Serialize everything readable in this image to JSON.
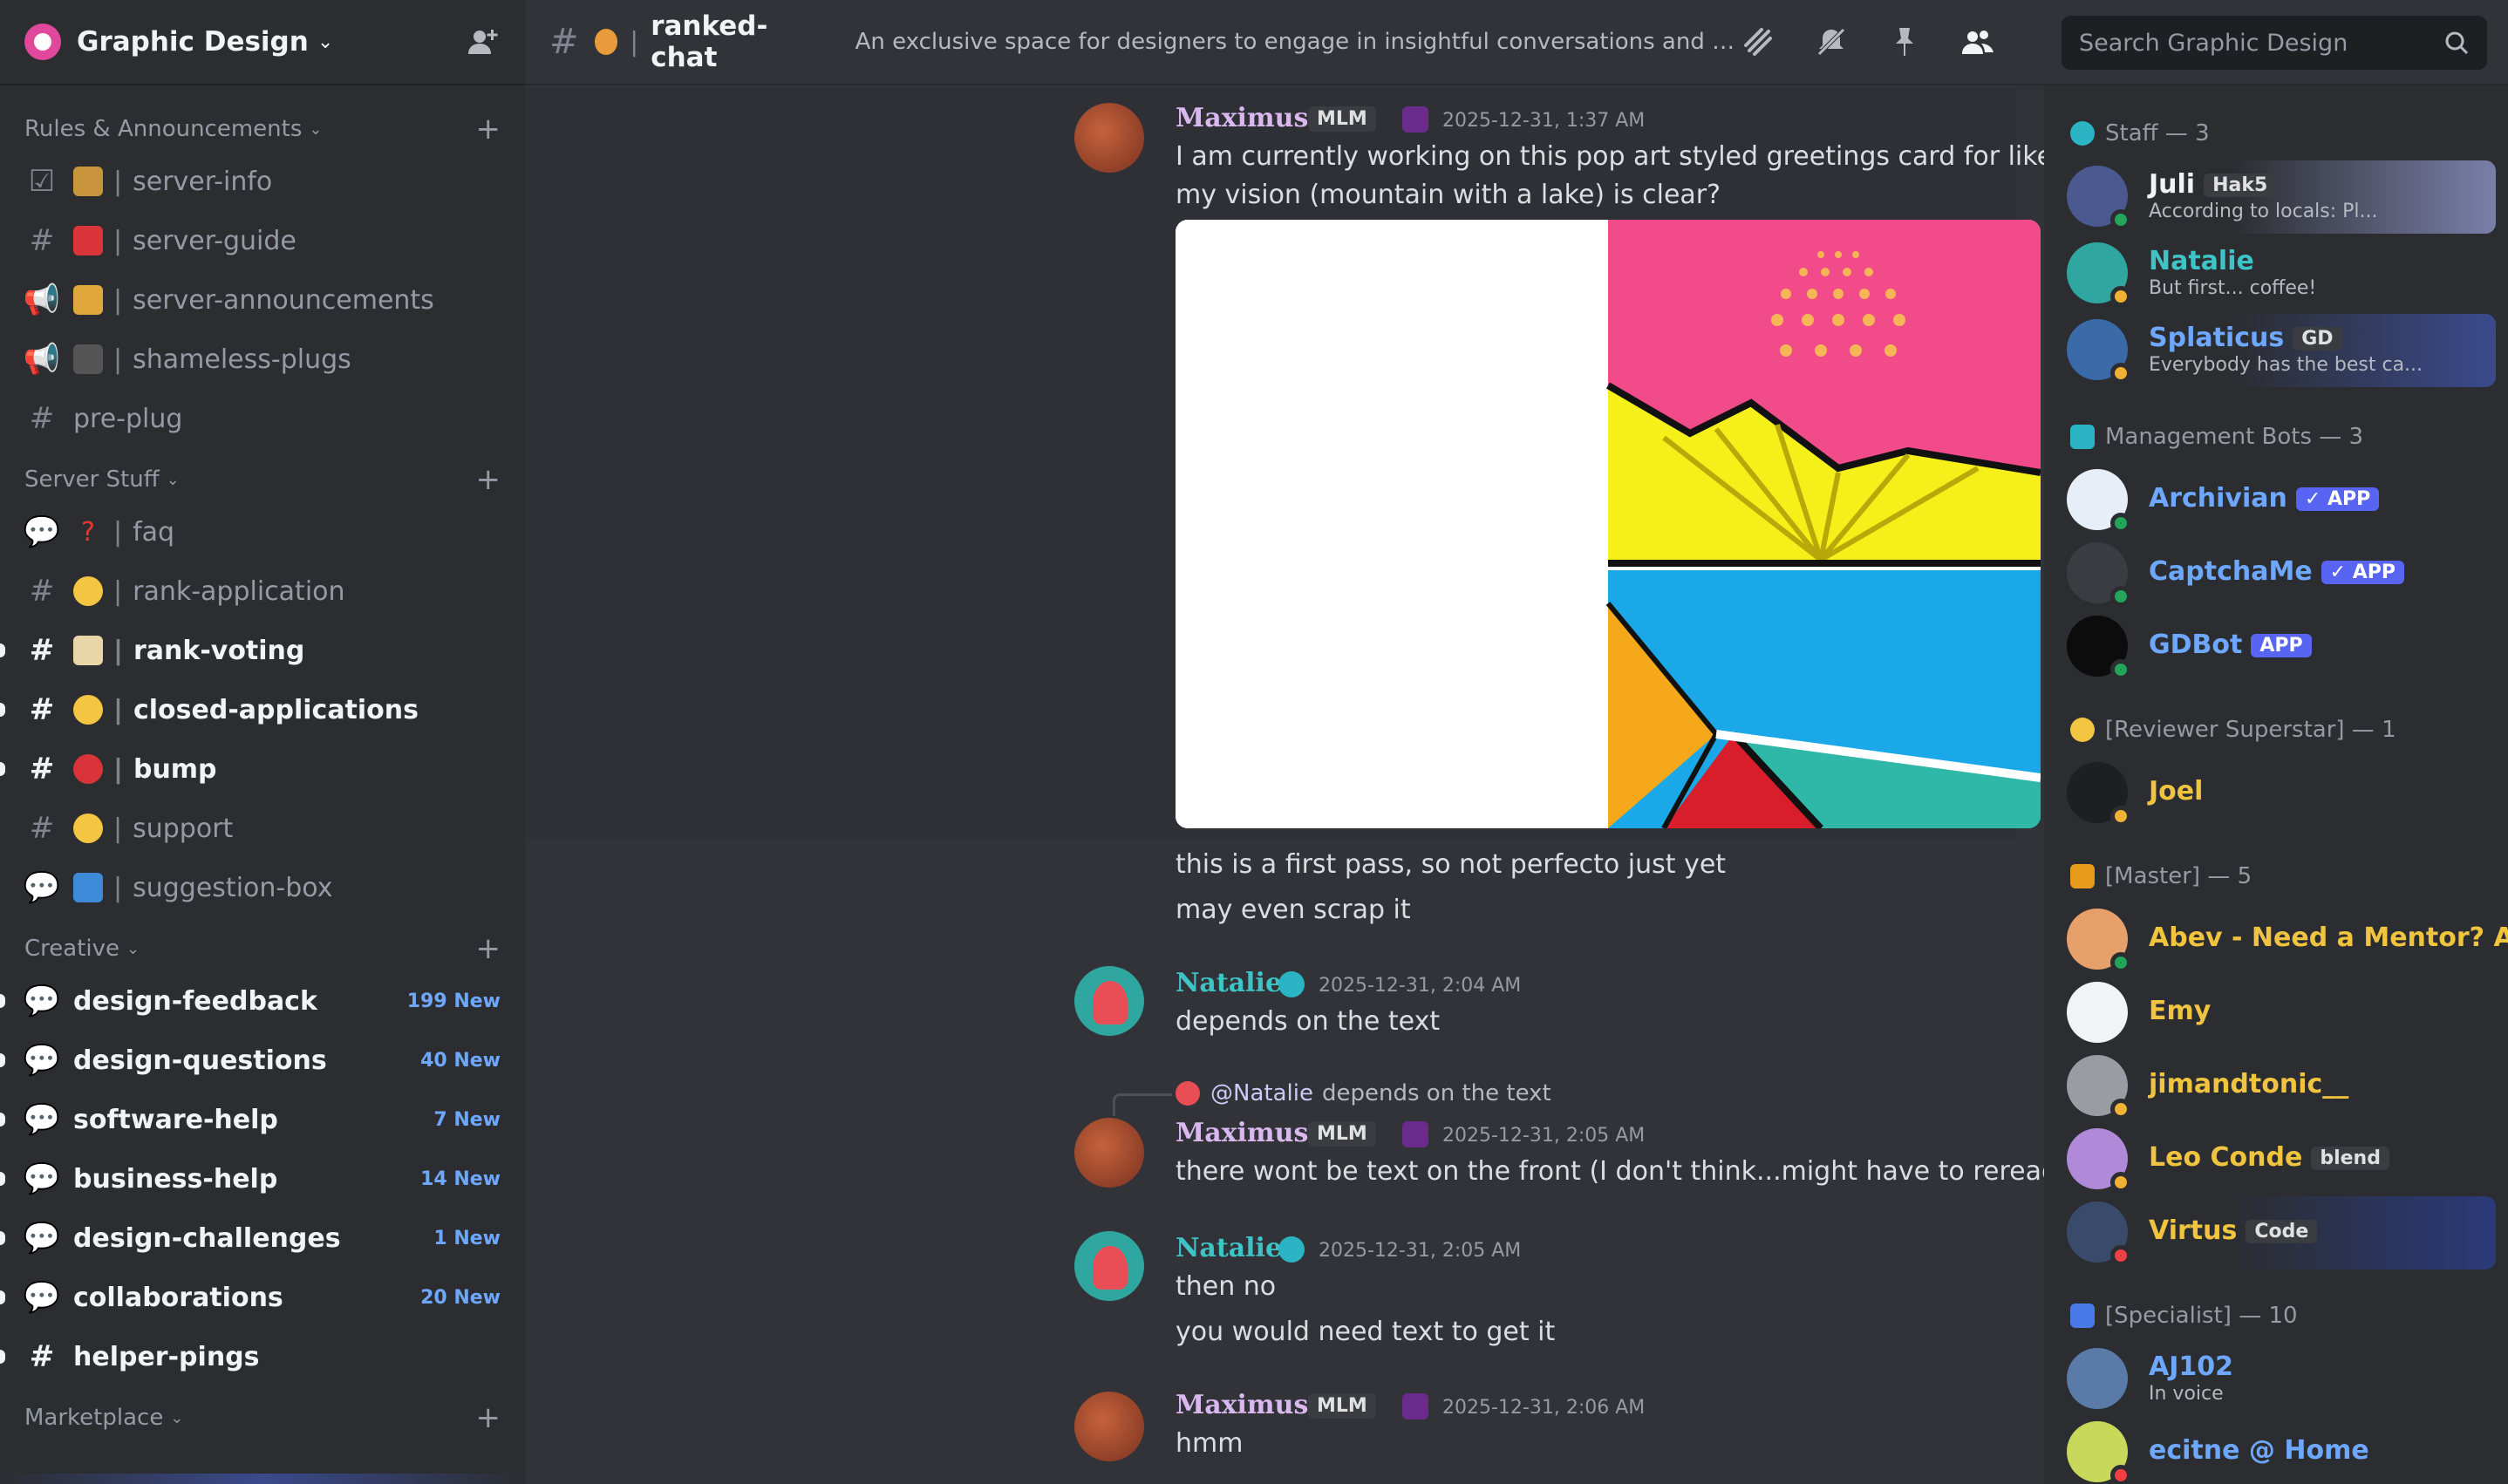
{
  "server": {
    "name": "Graphic Design"
  },
  "channel_header": {
    "name": "ranked-chat",
    "topic": "An exclusive space for designers to engage in insightful conversations and share their...",
    "search_placeholder": "Search Graphic Design"
  },
  "sidebar": {
    "categories": [
      {
        "label": "Rules & Announcements",
        "channels": [
          {
            "label": "server-info"
          },
          {
            "label": "server-guide"
          },
          {
            "label": "server-announcements"
          },
          {
            "label": "shameless-plugs"
          },
          {
            "label": "pre-plug"
          }
        ]
      },
      {
        "label": "Server Stuff",
        "channels": [
          {
            "label": "faq"
          },
          {
            "label": "rank-application"
          },
          {
            "label": "rank-voting"
          },
          {
            "label": "closed-applications"
          },
          {
            "label": "bump"
          },
          {
            "label": "support"
          },
          {
            "label": "suggestion-box"
          }
        ]
      },
      {
        "label": "Creative",
        "channels": [
          {
            "label": "design-feedback",
            "new": "199 New"
          },
          {
            "label": "design-questions",
            "new": "40 New"
          },
          {
            "label": "software-help",
            "new": "7 New"
          },
          {
            "label": "business-help",
            "new": "14 New"
          },
          {
            "label": "design-challenges",
            "new": "1 New"
          },
          {
            "label": "collaborations",
            "new": "20 New"
          },
          {
            "label": "helper-pings"
          }
        ]
      },
      {
        "label": "Marketplace",
        "channels": []
      }
    ]
  },
  "messages": [
    {
      "author": "Maximus",
      "tag": "MLM",
      "time": "2025-12-31, 1:37 AM",
      "lines": [
        "I am currently working on this pop art styled greetings card for like an outdoor retreat place, and I can't tell if",
        "my vision (mountain with a lake) is clear?"
      ]
    },
    {
      "lines": [
        "this is a first pass, so not perfecto just yet",
        "may even scrap it"
      ]
    },
    {
      "author": "Natalie",
      "time": "2025-12-31, 2:04 AM",
      "lines": [
        "depends on the text"
      ]
    },
    {
      "reply_to": "@Natalie",
      "reply_text": "depends on the text",
      "author": "Maximus",
      "tag": "MLM",
      "time": "2025-12-31, 2:05 AM",
      "lines": [
        "there wont be text on the front (I don't think...might have to reread the brief)"
      ]
    },
    {
      "author": "Natalie",
      "time": "2025-12-31, 2:05 AM",
      "lines": [
        "then no",
        "you would need text to get it"
      ]
    },
    {
      "author": "Maximus",
      "tag": "MLM",
      "time": "2025-12-31, 2:06 AM",
      "lines": [
        "hmm"
      ]
    }
  ],
  "members": {
    "groups": [
      {
        "label": "Staff — 3",
        "items": [
          {
            "name": "Juli",
            "tag": "Hak5",
            "status": "According to locals: Pl...",
            "color": "#f2f3f5"
          },
          {
            "name": "Natalie",
            "status": "But first... coffee!",
            "color": "#3ec4c7"
          },
          {
            "name": "Splaticus",
            "tag": "GD",
            "status": "Everybody has the best ca...",
            "color": "#6ea8fe"
          }
        ]
      },
      {
        "label": "Management Bots — 3",
        "items": [
          {
            "name": "Archivian",
            "app": "✓ APP",
            "color": "#6ea8fe"
          },
          {
            "name": "CaptchaMe",
            "app": "✓ APP",
            "color": "#6ea8fe"
          },
          {
            "name": "GDBot",
            "app": "APP",
            "color": "#6ea8fe"
          }
        ]
      },
      {
        "label": "[Reviewer Superstar] — 1",
        "items": [
          {
            "name": "Joel",
            "color": "#f0c43f"
          }
        ]
      },
      {
        "label": "[Master] — 5",
        "items": [
          {
            "name": "Abev - Need a Mentor? A...",
            "color": "#f0c43f"
          },
          {
            "name": "Emy",
            "color": "#f0c43f"
          },
          {
            "name": "jimandtonic__",
            "color": "#f0c43f"
          },
          {
            "name": "Leo Conde",
            "tag": "blend",
            "color": "#f0c43f"
          },
          {
            "name": "Virtus",
            "tag": "Code",
            "color": "#f0c43f"
          }
        ]
      },
      {
        "label": "[Specialist] — 10",
        "items": [
          {
            "name": "AJ102",
            "status": "In voice",
            "color": "#6ea8fe"
          },
          {
            "name": "ecitne @ Home",
            "color": "#6ea8fe"
          }
        ]
      }
    ]
  },
  "colors": {
    "accent": "#5865f2",
    "online": "#23a55a",
    "idle": "#f0b232",
    "dnd": "#f23f43"
  }
}
